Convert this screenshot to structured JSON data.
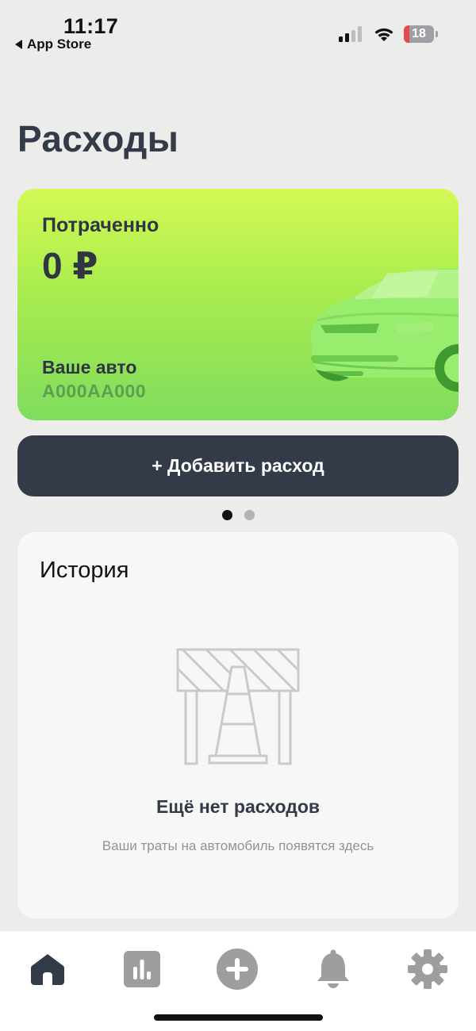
{
  "status_bar": {
    "time": "11:17",
    "back_label": "App Store",
    "battery_level": "18",
    "battery_fraction": 0.18
  },
  "page": {
    "title": "Расходы"
  },
  "spent_card": {
    "label": "Потраченно",
    "amount": "0 ₽",
    "car_label": "Ваше авто",
    "car_plate": "А000АА000"
  },
  "add_button": {
    "label": "+ Добавить расход"
  },
  "pager": {
    "count": 2,
    "active_index": 0
  },
  "history": {
    "title": "История",
    "empty_title": "Ещё нет расходов",
    "empty_subtitle": "Ваши траты на автомобиль появятся здесь"
  },
  "tab_bar": {
    "items": [
      {
        "icon": "home-icon",
        "active": true
      },
      {
        "icon": "stats-icon",
        "active": false
      },
      {
        "icon": "add-circle-icon",
        "active": false
      },
      {
        "icon": "bell-icon",
        "active": false
      },
      {
        "icon": "gear-icon",
        "active": false
      }
    ]
  },
  "colors": {
    "primary_dark": "#333A48",
    "card_green_top": "#D3F954",
    "card_green_bottom": "#80DC5E",
    "plate_green": "#5E9E52",
    "tab_inactive": "#9E9E9E",
    "battery_low": "#E5484D"
  }
}
